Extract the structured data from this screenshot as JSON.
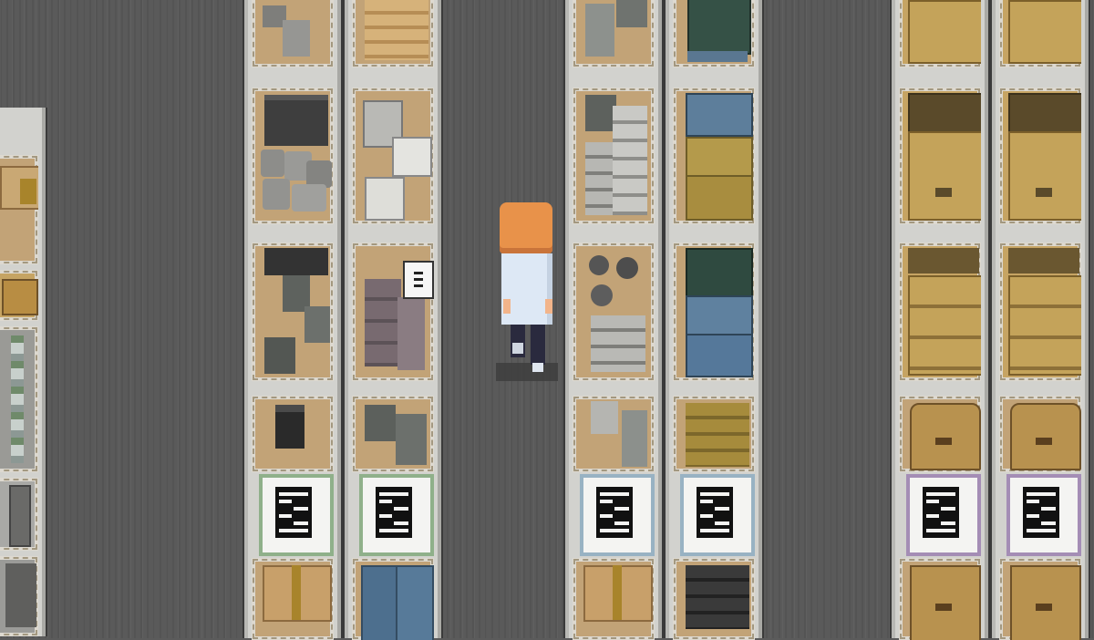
{
  "scene": {
    "name": "warehouse-aisles",
    "colors": {
      "floor": "#5a5a5a",
      "shelf_frame": "#d2d2ce",
      "cardboard": "#c2a377",
      "wood_crate": "#b8924f",
      "hair": "#e8924a",
      "coat": "#dde8f5",
      "card_border_green": "#8fb08a",
      "card_border_blue": "#98b2c3",
      "card_border_purple": "#a48db5"
    }
  },
  "shelves": [
    {
      "id": "shelf-a",
      "kind": "partial",
      "contents": [
        "cardboard-box",
        "gold-crate",
        "gas-cylinders",
        "metal-drum"
      ]
    },
    {
      "id": "shelf-b",
      "kind": "full",
      "contents": [
        "grey-boxes",
        "dark-cases",
        "rocks",
        "dark-bins",
        "dark-bin",
        "inventory-card-green",
        "cardboard-box-taped"
      ]
    },
    {
      "id": "shelf-c",
      "kind": "full",
      "contents": [
        "wooden-planks",
        "robot-boxes",
        "wall-sign",
        "grey-bins",
        "inventory-card-green",
        "blue-crates"
      ]
    },
    {
      "id": "shelf-d",
      "kind": "full",
      "contents": [
        "grey-boxes",
        "grey-stack",
        "stones",
        "grey-bins",
        "inventory-card-blue",
        "cardboard-box-taped"
      ]
    },
    {
      "id": "shelf-e",
      "kind": "full",
      "contents": [
        "teal-case",
        "blue-cases",
        "olive-cases",
        "teal-cases",
        "olive-chest",
        "inventory-card-blue",
        "black-cases"
      ]
    },
    {
      "id": "shelf-f",
      "kind": "full",
      "contents": [
        "wood-crates",
        "wood-crates",
        "wood-crates",
        "wood-chest",
        "inventory-card-purple",
        "wood-chest"
      ]
    },
    {
      "id": "shelf-g",
      "kind": "full",
      "contents": [
        "wood-crates",
        "wood-crates",
        "wood-crates",
        "wood-chest",
        "inventory-card-purple",
        "wood-chest"
      ]
    }
  ],
  "player": {
    "name": "warehouse-worker",
    "facing": "up"
  }
}
